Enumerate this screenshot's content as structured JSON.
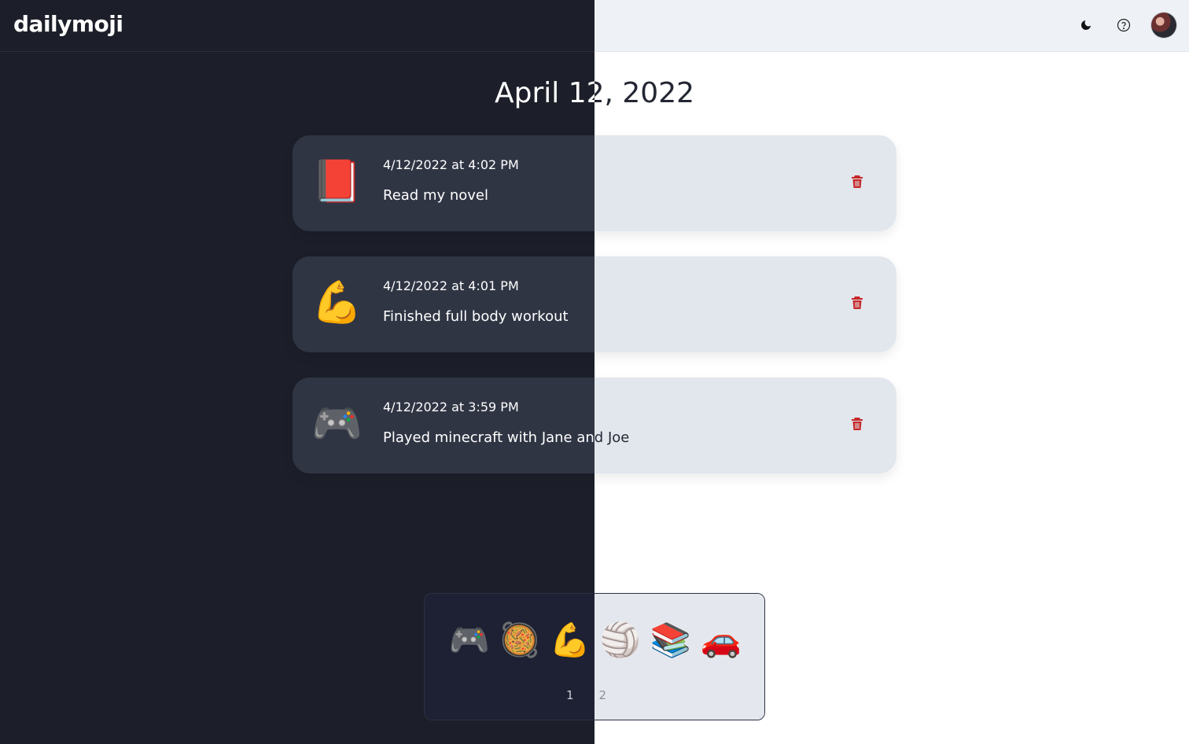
{
  "app": {
    "logo": "dailymoji"
  },
  "header": {
    "theme_icon": "moon-icon",
    "help_icon": "question-circle-icon",
    "avatar_alt": "user avatar"
  },
  "day": {
    "title": "April 12, 2022"
  },
  "entries": [
    {
      "emoji": "📕",
      "timestamp": "4/12/2022 at 4:02 PM",
      "text": "Read my novel"
    },
    {
      "emoji": "💪",
      "timestamp": "4/12/2022 at 4:01 PM",
      "text": "Finished full body workout"
    },
    {
      "emoji": "🎮",
      "timestamp": "4/12/2022 at 3:59 PM",
      "text": "Played minecraft with Jane and Joe"
    }
  ],
  "picker": {
    "emojis": [
      "🎮",
      "🥘",
      "💪",
      "🏐",
      "📚",
      "🚗"
    ],
    "pages": [
      "1",
      "2"
    ]
  },
  "colors": {
    "dark_bg": "#1c1f29",
    "card_dark": "#303544",
    "card_light": "#e2e6ed",
    "trash": "#c62828"
  }
}
